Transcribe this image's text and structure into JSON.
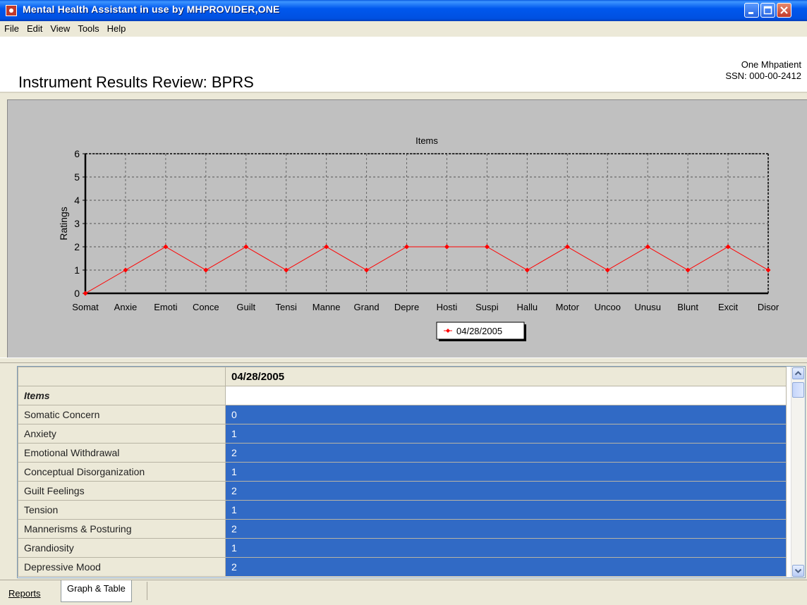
{
  "window": {
    "title": "Mental Health Assistant in use by MHPROVIDER,ONE"
  },
  "menu": [
    "File",
    "Edit",
    "View",
    "Tools",
    "Help"
  ],
  "header": {
    "title": "Instrument Results Review: BPRS",
    "patient_name": "One Mhpatient",
    "ssn": "SSN: 000-00-2412"
  },
  "chart_data": {
    "type": "line",
    "title": "Items",
    "xlabel": "",
    "ylabel": "Ratings",
    "ylim": [
      0,
      6
    ],
    "yticks": [
      0,
      1,
      2,
      3,
      4,
      5,
      6
    ],
    "grid": true,
    "legend": "bottom-center",
    "categories": [
      "Somat",
      "Anxie",
      "Emoti",
      "Conce",
      "Guilt",
      "Tensi",
      "Manne",
      "Grand",
      "Depre",
      "Hosti",
      "Suspi",
      "Hallu",
      "Motor",
      "Uncoo",
      "Unusu",
      "Blunt",
      "Excit",
      "Disor"
    ],
    "series": [
      {
        "name": "04/28/2005",
        "color": "#FF0000",
        "values": [
          0,
          1,
          2,
          1,
          2,
          1,
          2,
          1,
          2,
          2,
          2,
          1,
          2,
          1,
          2,
          1,
          2,
          1
        ]
      }
    ]
  },
  "table": {
    "date_header": "04/28/2005",
    "section_label": "Items",
    "rows": [
      {
        "item": "Somatic Concern",
        "value": "0"
      },
      {
        "item": "Anxiety",
        "value": "1"
      },
      {
        "item": "Emotional Withdrawal",
        "value": "2"
      },
      {
        "item": "Conceptual Disorganization",
        "value": "1"
      },
      {
        "item": "Guilt Feelings",
        "value": "2"
      },
      {
        "item": "Tension",
        "value": "1"
      },
      {
        "item": "Mannerisms & Posturing",
        "value": "2"
      },
      {
        "item": "Grandiosity",
        "value": "1"
      },
      {
        "item": "Depressive Mood",
        "value": "2"
      }
    ]
  },
  "tabs": {
    "reports": "Reports",
    "graph_table": "Graph & Table"
  }
}
